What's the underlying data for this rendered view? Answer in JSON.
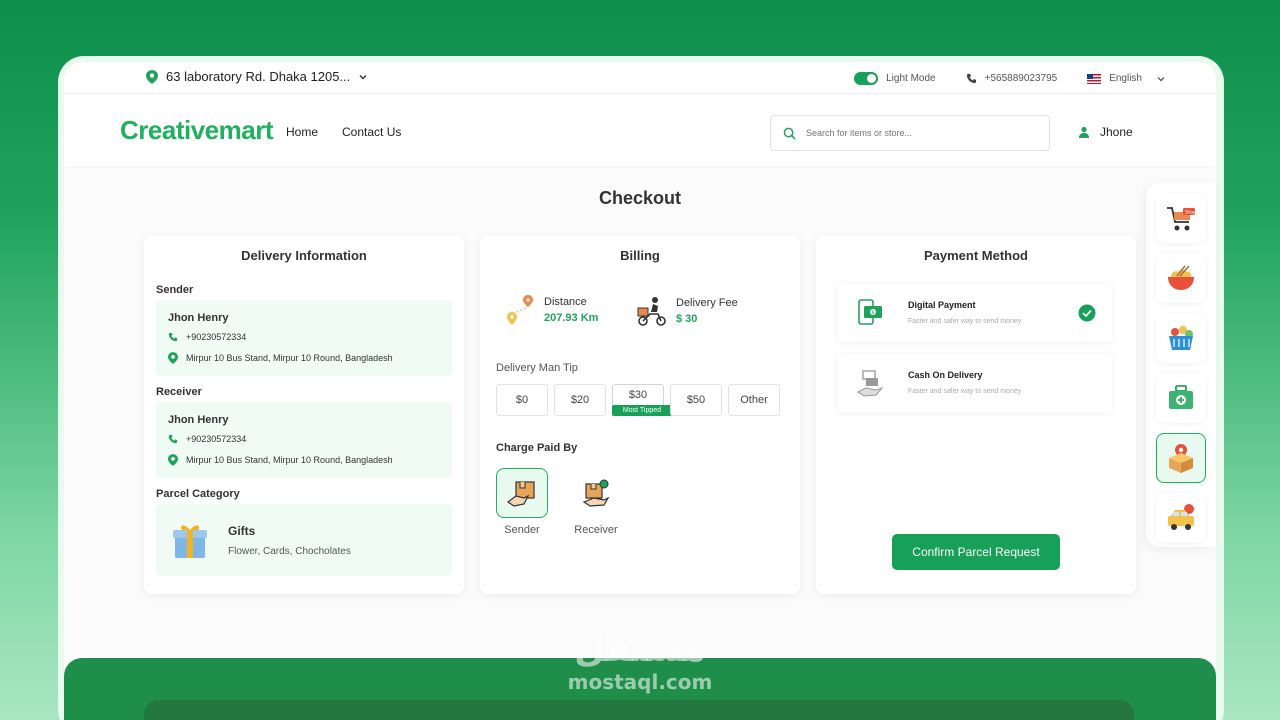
{
  "topbar": {
    "location": "63 laboratory Rd. Dhaka 1205...",
    "theme_label": "Light Mode",
    "phone": "+565889023795",
    "language": "English"
  },
  "header": {
    "logo": "Creativemart",
    "nav": [
      "Home",
      "Contact Us"
    ],
    "search_placeholder": "Search for items or store...",
    "user_name": "Jhone"
  },
  "page_title": "Checkout",
  "delivery": {
    "title": "Delivery Information",
    "sender_label": "Sender",
    "sender": {
      "name": "Jhon Henry",
      "phone": "+90230572334",
      "address": "Mirpur 10 Bus Stand, Mirpur 10 Round, Bangladesh"
    },
    "receiver_label": "Receiver",
    "receiver": {
      "name": "Jhon Henry",
      "phone": "+90230572334",
      "address": "Mirpur 10 Bus Stand, Mirpur 10 Round, Bangladesh"
    },
    "parcel_label": "Parcel Category",
    "parcel": {
      "name": "Gifts",
      "description": "Flower, Cards, Chocholates"
    }
  },
  "billing": {
    "title": "Billing",
    "distance_label": "Distance",
    "distance_value": "207.93 Km",
    "fee_label": "Delivery Fee",
    "fee_value": "$ 30",
    "tip_label": "Delivery Man Tip",
    "tips": [
      "$0",
      "$20",
      "$30",
      "$50",
      "Other"
    ],
    "tip_badge": "Most Tipped",
    "selected_tip": "$30",
    "charge_label": "Charge Paid By",
    "payers": [
      "Sender",
      "Receiver"
    ],
    "selected_payer": "Sender"
  },
  "payment": {
    "title": "Payment Method",
    "options": [
      {
        "name": "Digital Payment",
        "desc": "Faster and safer way to send money",
        "selected": true
      },
      {
        "name": "Cash On Delivery",
        "desc": "Faster and safer way to send money",
        "selected": false
      }
    ],
    "confirm_label": "Confirm Parcel Request"
  },
  "categories": [
    "shop-icon",
    "food-icon",
    "grocery-icon",
    "pharmacy-icon",
    "parcel-icon",
    "taxi-icon"
  ],
  "selected_category": "parcel-icon",
  "watermark": {
    "arabic": "مستقل",
    "latin": "mostaql.com"
  },
  "colors": {
    "brand": "#21b05f",
    "accent": "#17a058",
    "light": "#f1fbf5"
  }
}
